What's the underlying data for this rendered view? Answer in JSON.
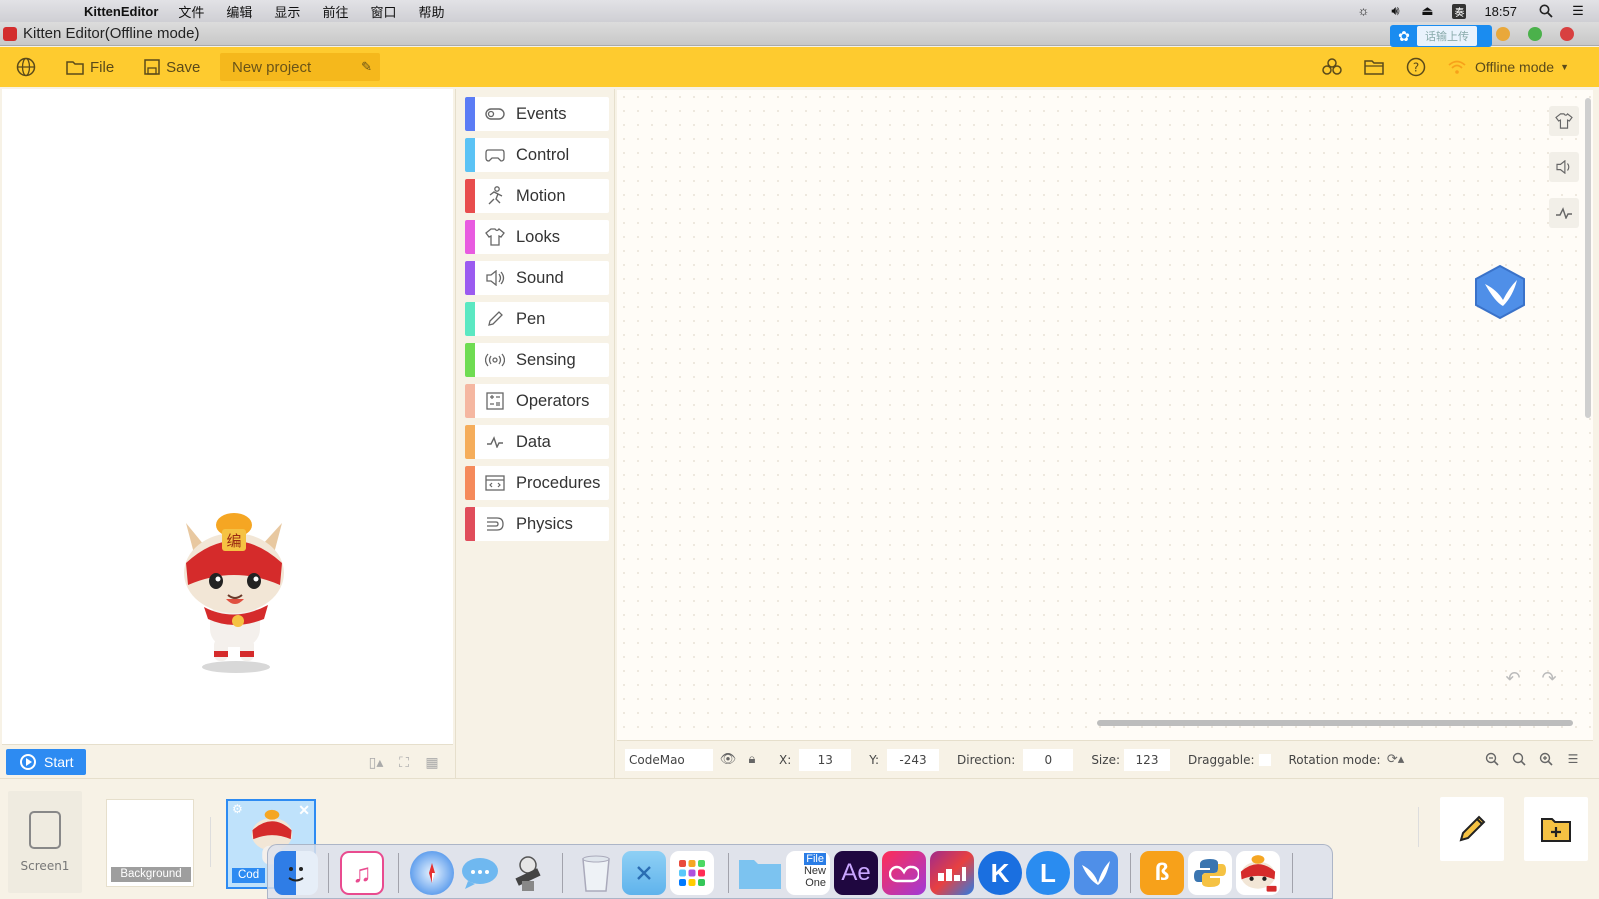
{
  "menubar": {
    "app_name": "KittenEditor",
    "items": [
      "文件",
      "编辑",
      "显示",
      "前往",
      "窗口",
      "帮助"
    ],
    "clock": "18:57",
    "input_method": "奏"
  },
  "window": {
    "title": "Kitten Editor(Offline mode)",
    "upload_label": "话输上传"
  },
  "toolbar": {
    "file_label": "File",
    "save_label": "Save",
    "project_name": "New project",
    "mode_label": "Offline mode"
  },
  "stage": {
    "start_label": "Start"
  },
  "categories": [
    {
      "label": "Events",
      "color": "#5b7cf5",
      "icon": "toggle-icon"
    },
    {
      "label": "Control",
      "color": "#5bc3f5",
      "icon": "gamepad-icon"
    },
    {
      "label": "Motion",
      "color": "#e84d4d",
      "icon": "running-icon"
    },
    {
      "label": "Looks",
      "color": "#e85be0",
      "icon": "shirt-icon"
    },
    {
      "label": "Sound",
      "color": "#9b5bf0",
      "icon": "speaker-icon"
    },
    {
      "label": "Pen",
      "color": "#5be8c2",
      "icon": "pen-icon"
    },
    {
      "label": "Sensing",
      "color": "#6fdc52",
      "icon": "sensor-icon"
    },
    {
      "label": "Operators",
      "color": "#f5b7a1",
      "icon": "calculator-icon"
    },
    {
      "label": "Data",
      "color": "#f5ad5b",
      "icon": "data-icon"
    },
    {
      "label": "Procedures",
      "color": "#f58a5b",
      "icon": "procedure-icon"
    },
    {
      "label": "Physics",
      "color": "#e04d5b",
      "icon": "physics-icon"
    }
  ],
  "sprite_info": {
    "name": "CodeMao",
    "x_label": "X:",
    "x": "13",
    "y_label": "Y:",
    "y": "-243",
    "direction_label": "Direction:",
    "direction": "0",
    "size_label": "Size:",
    "size": "123",
    "draggable_label": "Draggable:",
    "rotation_label": "Rotation mode:"
  },
  "bottom": {
    "screen_label": "Screen1",
    "background_label": "Background",
    "sprite_label": "Cod"
  },
  "dock": {
    "file_label": "File",
    "new_label": "New",
    "one_label": "One",
    "ae_label": "Ae"
  },
  "colors": {
    "toolbar": "#fecb2f",
    "accent": "#2d8bf2"
  }
}
